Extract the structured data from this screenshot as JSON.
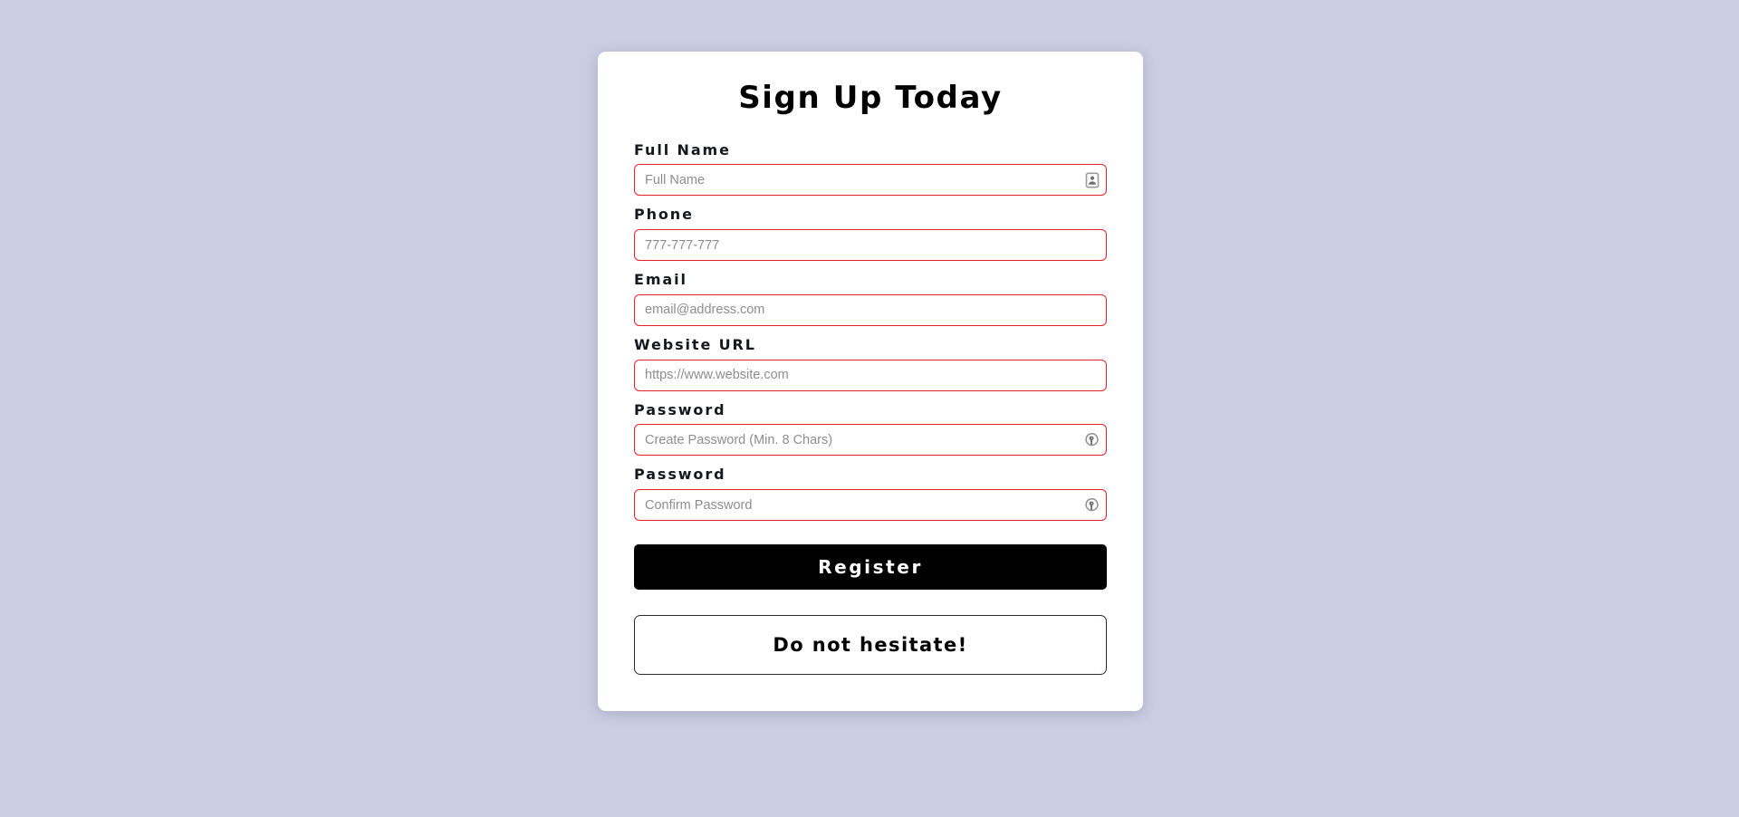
{
  "page": {
    "background_color": "#cbcde3",
    "card_background": "#ffffff"
  },
  "form": {
    "title": "Sign Up Today",
    "accent_border_color": "#e3202a",
    "fields": [
      {
        "label": "Full Name",
        "placeholder": "Full Name",
        "value": "",
        "type": "text",
        "icon": "contact-card-icon",
        "name": "full-name"
      },
      {
        "label": "Phone",
        "placeholder": "777-777-777",
        "value": "",
        "type": "tel",
        "icon": "",
        "name": "phone"
      },
      {
        "label": "Email",
        "placeholder": "email@address.com",
        "value": "",
        "type": "email",
        "icon": "",
        "name": "email"
      },
      {
        "label": "Website URL",
        "placeholder": "https://www.website.com",
        "value": "",
        "type": "url",
        "icon": "",
        "name": "website-url"
      },
      {
        "label": "Password",
        "placeholder": "Create Password (Min. 8 Chars)",
        "value": "",
        "type": "password",
        "icon": "key-circle-icon",
        "name": "password"
      },
      {
        "label": "Password",
        "placeholder": "Confirm Password",
        "value": "",
        "type": "password",
        "icon": "key-circle-icon",
        "name": "confirm-password"
      }
    ],
    "submit_label": "Register",
    "footer_label": "Do not hesitate!"
  }
}
